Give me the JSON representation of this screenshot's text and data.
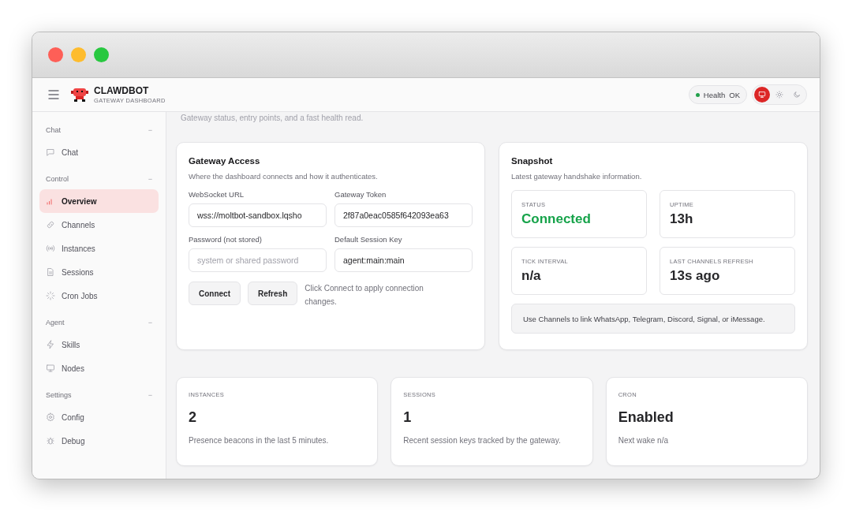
{
  "window": {
    "controls": [
      {
        "color": "#fe5f57"
      },
      {
        "color": "#febc2e"
      },
      {
        "color": "#28c840"
      }
    ]
  },
  "header": {
    "brand": "CLAWDBOT",
    "subtitle": "GATEWAY DASHBOARD",
    "health": {
      "label": "Health",
      "value": "OK",
      "color": "#22a04b"
    },
    "theme_options": [
      {
        "kind": "system",
        "selected": true
      },
      {
        "kind": "light",
        "selected": false
      },
      {
        "kind": "dark",
        "selected": false
      }
    ]
  },
  "sidebar": {
    "groups": [
      {
        "label": "Chat",
        "toggle": "−",
        "items": [
          {
            "label": "Chat",
            "selected": false
          }
        ]
      },
      {
        "label": "Control",
        "toggle": "−",
        "items": [
          {
            "label": "Overview",
            "selected": true
          },
          {
            "label": "Channels",
            "selected": false
          },
          {
            "label": "Instances",
            "selected": false
          },
          {
            "label": "Sessions",
            "selected": false
          },
          {
            "label": "Cron Jobs",
            "selected": false
          }
        ]
      },
      {
        "label": "Agent",
        "toggle": "−",
        "items": [
          {
            "label": "Skills",
            "selected": false
          },
          {
            "label": "Nodes",
            "selected": false
          }
        ]
      },
      {
        "label": "Settings",
        "toggle": "−",
        "items": [
          {
            "label": "Config",
            "selected": false
          },
          {
            "label": "Debug",
            "selected": false
          }
        ]
      }
    ]
  },
  "page": {
    "subtitle": "Gateway status, entry points, and a fast health read."
  },
  "gateway_access": {
    "title": "Gateway Access",
    "description": "Where the dashboard connects and how it authenticates.",
    "fields": [
      {
        "label": "WebSocket URL",
        "value": "wss://moltbot-sandbox.lqsho"
      },
      {
        "label": "Gateway Token",
        "value": "2f87a0eac0585f642093ea63"
      },
      {
        "label": "Password (not stored)",
        "placeholder": "system or shared password"
      },
      {
        "label": "Default Session Key",
        "value": "agent:main:main"
      }
    ],
    "buttons": [
      "Connect",
      "Refresh"
    ],
    "hint": "Click Connect to apply connection changes."
  },
  "snapshot": {
    "title": "Snapshot",
    "description": "Latest gateway handshake information.",
    "stats": [
      {
        "label": "STATUS",
        "value": "Connected",
        "color": "#16a34a"
      },
      {
        "label": "UPTIME",
        "value": "13h",
        "color": "#27272a"
      },
      {
        "label": "TICK INTERVAL",
        "value": "n/a",
        "color": "#27272a"
      },
      {
        "label": "LAST CHANNELS REFRESH",
        "value": "13s ago",
        "color": "#27272a"
      }
    ],
    "note": "Use Channels to link WhatsApp, Telegram, Discord, Signal, or iMessage."
  },
  "summary_cards": [
    {
      "label": "INSTANCES",
      "value": "2",
      "detail": "Presence beacons in the last 5 minutes."
    },
    {
      "label": "SESSIONS",
      "value": "1",
      "detail": "Recent session keys tracked by the gateway."
    },
    {
      "label": "CRON",
      "value": "Enabled",
      "detail": "Next wake n/a"
    }
  ]
}
